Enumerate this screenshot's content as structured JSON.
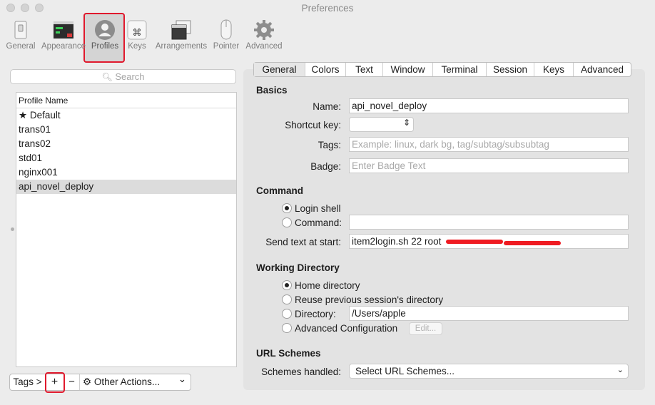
{
  "window": {
    "title": "Preferences"
  },
  "toolbar": {
    "items": [
      {
        "label": "General",
        "icon": "general-switch-icon"
      },
      {
        "label": "Appearance",
        "icon": "appearance-terminal-icon"
      },
      {
        "label": "Profiles",
        "icon": "profile-person-icon"
      },
      {
        "label": "Keys",
        "icon": "command-key-icon"
      },
      {
        "label": "Arrangements",
        "icon": "arrangements-windows-icon"
      },
      {
        "label": "Pointer",
        "icon": "mouse-icon"
      },
      {
        "label": "Advanced",
        "icon": "gear-icon"
      }
    ],
    "selected": "Profiles"
  },
  "search": {
    "placeholder": "Search"
  },
  "profile_list": {
    "header": "Profile Name",
    "rows": [
      "★ Default",
      "trans01",
      "trans02",
      "std01",
      "nginx001",
      "api_novel_deploy"
    ],
    "selected": "api_novel_deploy"
  },
  "bottom_bar": {
    "tags_label": "Tags >",
    "add_label": "+",
    "remove_label": "−",
    "other_actions_label": "Other Actions...",
    "chevron": "⌄"
  },
  "tabs": [
    "General",
    "Colors",
    "Text",
    "Window",
    "Terminal",
    "Session",
    "Keys",
    "Advanced"
  ],
  "active_tab": "General",
  "basics": {
    "heading": "Basics",
    "name_label": "Name:",
    "name_value": "api_novel_deploy",
    "shortcut_label": "Shortcut key:",
    "tags_label": "Tags:",
    "tags_placeholder": "Example: linux, dark bg, tag/subtag/subsubtag",
    "badge_label": "Badge:",
    "badge_placeholder": "Enter Badge Text"
  },
  "command": {
    "heading": "Command",
    "login_shell_label": "Login shell",
    "command_label": "Command:",
    "command_value": "",
    "send_text_label": "Send text at start:",
    "send_text_value": "item2login.sh 22 root"
  },
  "working_directory": {
    "heading": "Working Directory",
    "home_label": "Home directory",
    "reuse_label": "Reuse previous session's directory",
    "directory_label": "Directory:",
    "directory_value": "/Users/apple",
    "advanced_label": "Advanced Configuration",
    "edit_label": "Edit..."
  },
  "url_schemes": {
    "heading": "URL Schemes",
    "schemes_label": "Schemes handled:",
    "schemes_value": "Select URL Schemes..."
  },
  "colors": {
    "highlight": "#e0192d",
    "redaction": "#ef1b22"
  }
}
